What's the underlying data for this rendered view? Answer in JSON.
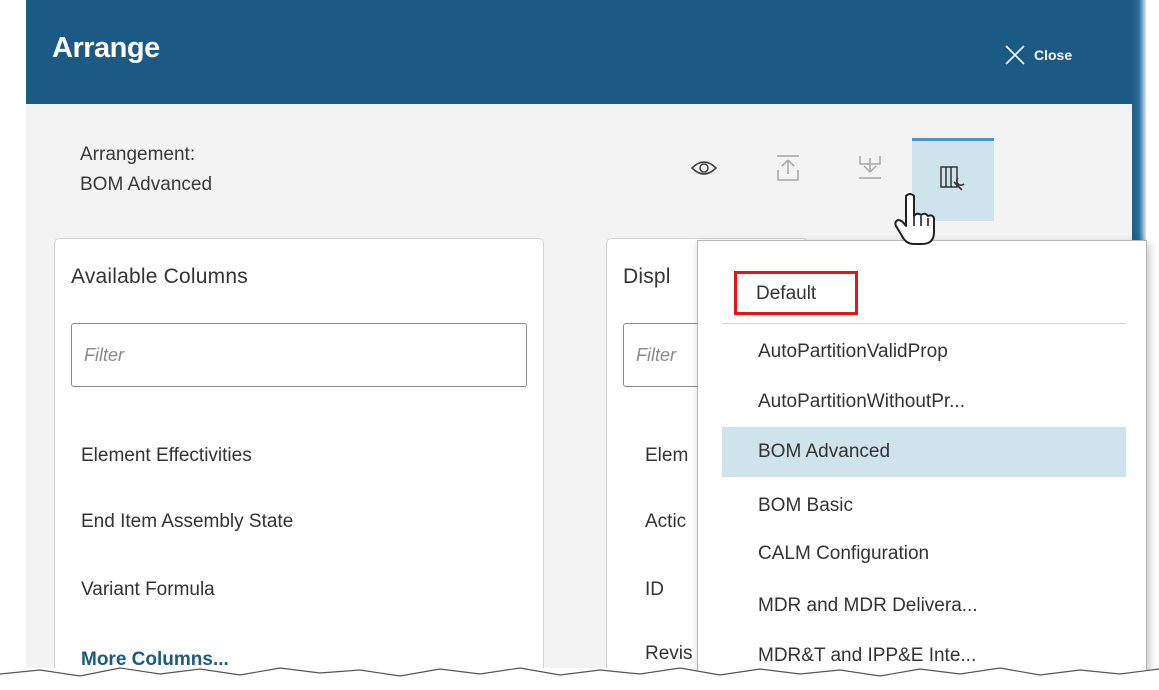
{
  "dialog": {
    "title": "Arrange",
    "close_label": "Close"
  },
  "arrangement": {
    "label": "Arrangement:",
    "value": "BOM Advanced"
  },
  "toolbar": {
    "icons": [
      "eye-icon",
      "upload-icon",
      "download-icon",
      "arrangement-settings-icon"
    ]
  },
  "available_columns": {
    "title": "Available Columns",
    "filter_placeholder": "Filter",
    "items": [
      "Element Effectivities",
      "End Item Assembly State",
      "Variant Formula"
    ],
    "more_link": "More Columns..."
  },
  "displayed_columns": {
    "title": "Displ",
    "filter_placeholder": "Filter",
    "items": [
      "Elem",
      "Actic",
      "ID",
      "Revis"
    ]
  },
  "arrangement_menu": {
    "items": [
      "Default",
      "AutoPartitionValidProp",
      "AutoPartitionWithoutPr...",
      "BOM Advanced",
      "BOM Basic",
      "CALM Configuration",
      "MDR and MDR Delivera...",
      "MDR&T and IPP&E Inte..."
    ],
    "selected_index": 3,
    "highlighted_index": 0
  },
  "colors": {
    "header_bg": "#1b5a84",
    "selected_bg": "#cfe3ec",
    "highlight_border": "#e3151a",
    "link": "#1b5a84"
  }
}
